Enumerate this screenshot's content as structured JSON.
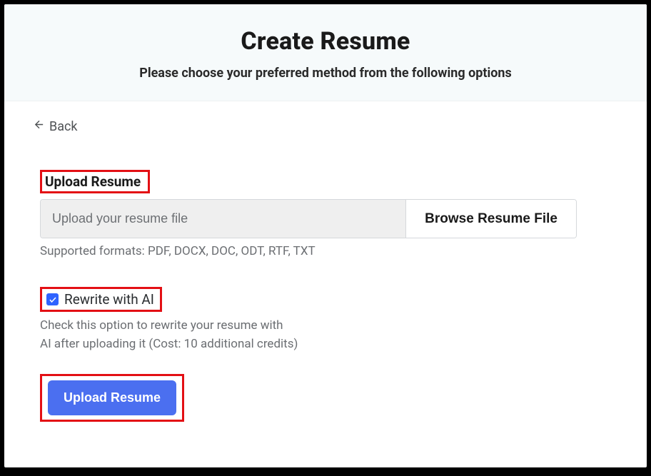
{
  "header": {
    "title": "Create Resume",
    "subtitle": "Please choose your preferred method from the following options"
  },
  "back": {
    "label": "Back"
  },
  "upload": {
    "section_label": "Upload Resume",
    "placeholder": "Upload your resume file",
    "browse_label": "Browse Resume File",
    "hint": "Supported formats: PDF, DOCX, DOC, ODT, RTF, TXT"
  },
  "rewrite": {
    "label": "Rewrite with AI",
    "checked": true,
    "desc_line1": "Check this option to rewrite your resume with",
    "desc_line2": "AI after uploading it (Cost: 10 additional credits)"
  },
  "submit": {
    "label": "Upload Resume"
  },
  "highlight_color": "#e30f14"
}
